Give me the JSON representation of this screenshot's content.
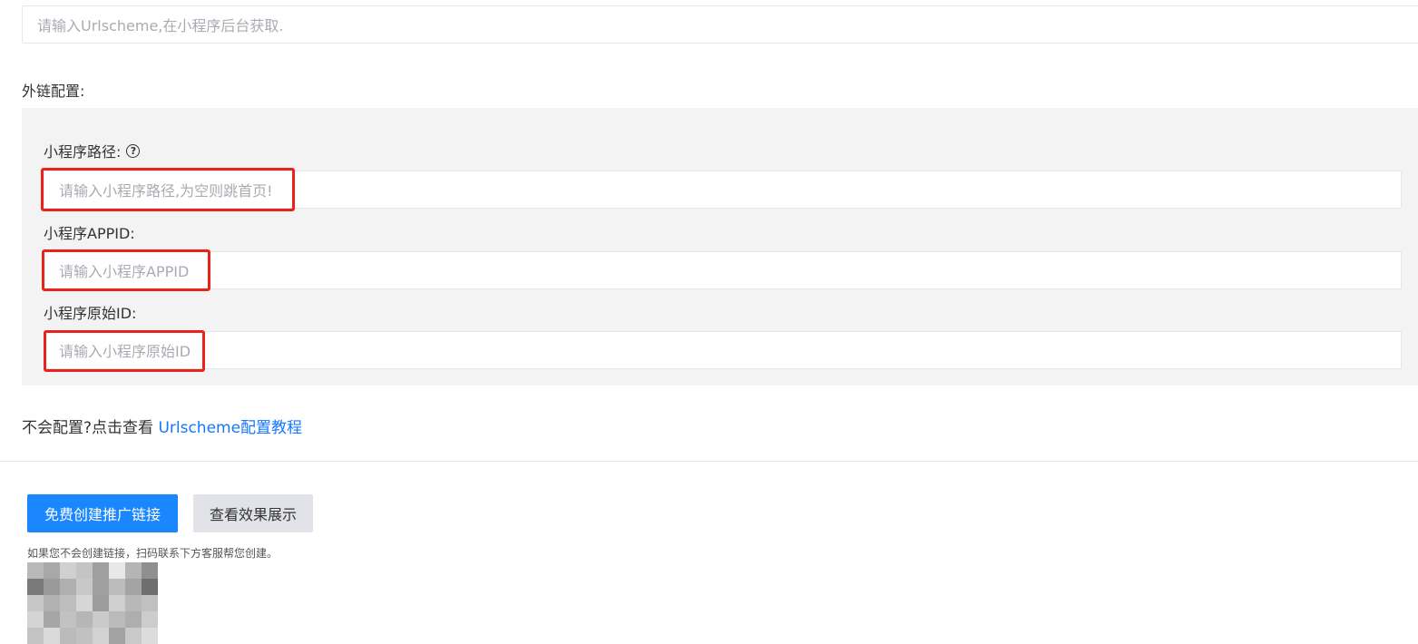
{
  "urlscheme": {
    "placeholder": "请输入Urlscheme,在小程序后台获取."
  },
  "external_link": {
    "section_label": "外链配置:",
    "fields": [
      {
        "label": "小程序路径:",
        "placeholder": "请输入小程序路径,为空则跳首页!",
        "help_icon": "question-circle-icon"
      },
      {
        "label": "小程序APPID:",
        "placeholder": "请输入小程序APPID"
      },
      {
        "label": "小程序原始ID:",
        "placeholder": "请输入小程序原始ID"
      }
    ]
  },
  "help": {
    "text": "不会配置?点击查看",
    "link_label": "Urlscheme配置教程"
  },
  "actions": {
    "create_label": "免费创建推广链接",
    "preview_label": "查看效果展示"
  },
  "note": "如果您不会创建链接，扫码联系下方客服帮您创建。",
  "colors": {
    "primary": "#1a87ff",
    "link": "#1677ff",
    "highlight": "#e8231b",
    "panel_bg": "#f3f3f3"
  }
}
